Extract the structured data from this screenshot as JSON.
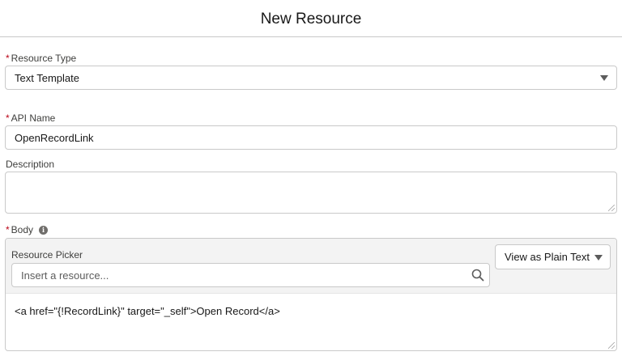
{
  "header": {
    "title": "New Resource"
  },
  "resource_type": {
    "label": "Resource Type",
    "required_mark": "*",
    "value": "Text Template"
  },
  "api_name": {
    "label": "API Name",
    "required_mark": "*",
    "value": "OpenRecordLink"
  },
  "description": {
    "label": "Description",
    "value": ""
  },
  "body": {
    "label": "Body",
    "required_mark": "*",
    "info_icon_glyph": "i",
    "picker_label": "Resource Picker",
    "picker_placeholder": "Insert a resource...",
    "view_mode": "View as Plain Text",
    "content": "<a href=\"{!RecordLink}\" target=\"_self\">Open Record</a>"
  },
  "icons": {
    "select_caret": "chevron-down-icon",
    "view_caret": "chevron-down-icon",
    "search": "search-icon",
    "info": "info-icon"
  },
  "colors": {
    "required": "#ba0517",
    "border": "#c9c9c9",
    "toolbar_bg": "#f3f3f3"
  }
}
